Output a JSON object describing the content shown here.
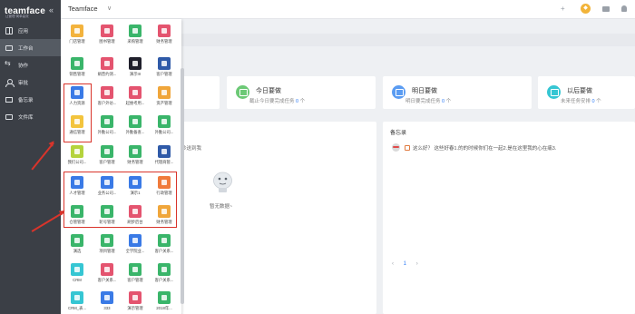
{
  "sidebar": {
    "brand": "teamface",
    "slogan": "让管理·简单高效",
    "items": [
      {
        "label": "应用",
        "icon": "grid-icon"
      },
      {
        "label": "工作台",
        "icon": "monitor-icon"
      },
      {
        "label": "协作",
        "icon": "share-icon"
      },
      {
        "label": "审批",
        "icon": "user-icon"
      },
      {
        "label": "备忘录",
        "icon": "mail-icon"
      },
      {
        "label": "文件库",
        "icon": "folder-icon"
      }
    ]
  },
  "topbar": {
    "title": "Teamface",
    "caret": "∨",
    "plus": "+",
    "tag": "◆"
  },
  "cards": [
    {
      "title": "今日要做",
      "sub_prefix": "截止今日要完成任务",
      "count": "0",
      "sub_suffix": "个",
      "color": "#6cc976"
    },
    {
      "title": "明日要做",
      "sub_prefix": "明日要完成任务",
      "count": "0",
      "sub_suffix": "个",
      "color": "#5b9cf2"
    },
    {
      "title": "以后要做",
      "sub_prefix": "未来任务安排",
      "count": "0",
      "sub_suffix": "个",
      "color": "#36c6d3"
    }
  ],
  "panel_left": {
    "sub": "秒送到我",
    "empty": "暂无数据~"
  },
  "panel_right": {
    "title": "备忘录",
    "memo": "这么好？ 这些好春1.的的时候你们在一起2.是在这里我的心在痛3.",
    "pager_prev": "‹",
    "pager_cur": "1",
    "pager_next": "›"
  },
  "apps": [
    {
      "label": "门店管理",
      "color": "#f3b33d"
    },
    {
      "label": "图书管理",
      "color": "#e4546f"
    },
    {
      "label": "采购管理",
      "color": "#3ab56a"
    },
    {
      "label": "财务管理",
      "color": "#e4546f"
    },
    {
      "label": "销售管理",
      "color": "#3ab56a"
    },
    {
      "label": "娟普约测...",
      "color": "#e4546f"
    },
    {
      "label": "演示III",
      "color": "#1f1f2b"
    },
    {
      "label": "客户管理",
      "color": "#2f5aa8"
    },
    {
      "label": "人力资源",
      "color": "#3a7ae6"
    },
    {
      "label": "客户外访...",
      "color": "#e4546f"
    },
    {
      "label": "起维考用...",
      "color": "#e4546f"
    },
    {
      "label": "资产管理",
      "color": "#f0a63b"
    },
    {
      "label": "通信管理",
      "color": "#f3c43d"
    },
    {
      "label": "外勤公司...",
      "color": "#3ab56a"
    },
    {
      "label": "外勤备查...",
      "color": "#3ab56a"
    },
    {
      "label": "外勤公司...",
      "color": "#3ab56a"
    },
    {
      "label": "我们公司...",
      "color": "#b5d33d"
    },
    {
      "label": "客户管理",
      "color": "#3ab56a"
    },
    {
      "label": "财务管理",
      "color": "#3ab56a"
    },
    {
      "label": "代理商管...",
      "color": "#2f5aa8"
    },
    {
      "label": "人才管理",
      "color": "#3a7ae6"
    },
    {
      "label": "业务公司...",
      "color": "#3a7ae6"
    },
    {
      "label": "演示1",
      "color": "#3a7ae6"
    },
    {
      "label": "行政管理",
      "color": "#f07a3b"
    },
    {
      "label": "仓管管理",
      "color": "#3ab56a"
    },
    {
      "label": "轮号管理",
      "color": "#3ab56a"
    },
    {
      "label": "刷步后台",
      "color": "#e4546f"
    },
    {
      "label": "财务管理",
      "color": "#f0a63b"
    },
    {
      "label": "演选",
      "color": "#3ab56a"
    },
    {
      "label": "项目管理",
      "color": "#3ab56a"
    },
    {
      "label": "全学院业...",
      "color": "#3a7ae6"
    },
    {
      "label": "客户关系...",
      "color": "#3ab56a"
    },
    {
      "label": "CRM",
      "color": "#36c6d3"
    },
    {
      "label": "客户关系...",
      "color": "#e4546f"
    },
    {
      "label": "客户管理",
      "color": "#3ab56a"
    },
    {
      "label": "客户关系...",
      "color": "#3ab56a"
    },
    {
      "label": "CRM_表...",
      "color": "#36c6d3"
    },
    {
      "label": "333",
      "color": "#3a7ae6"
    },
    {
      "label": "演示管理",
      "color": "#e4546f"
    },
    {
      "label": "2018年...",
      "color": "#3ab56a"
    }
  ]
}
